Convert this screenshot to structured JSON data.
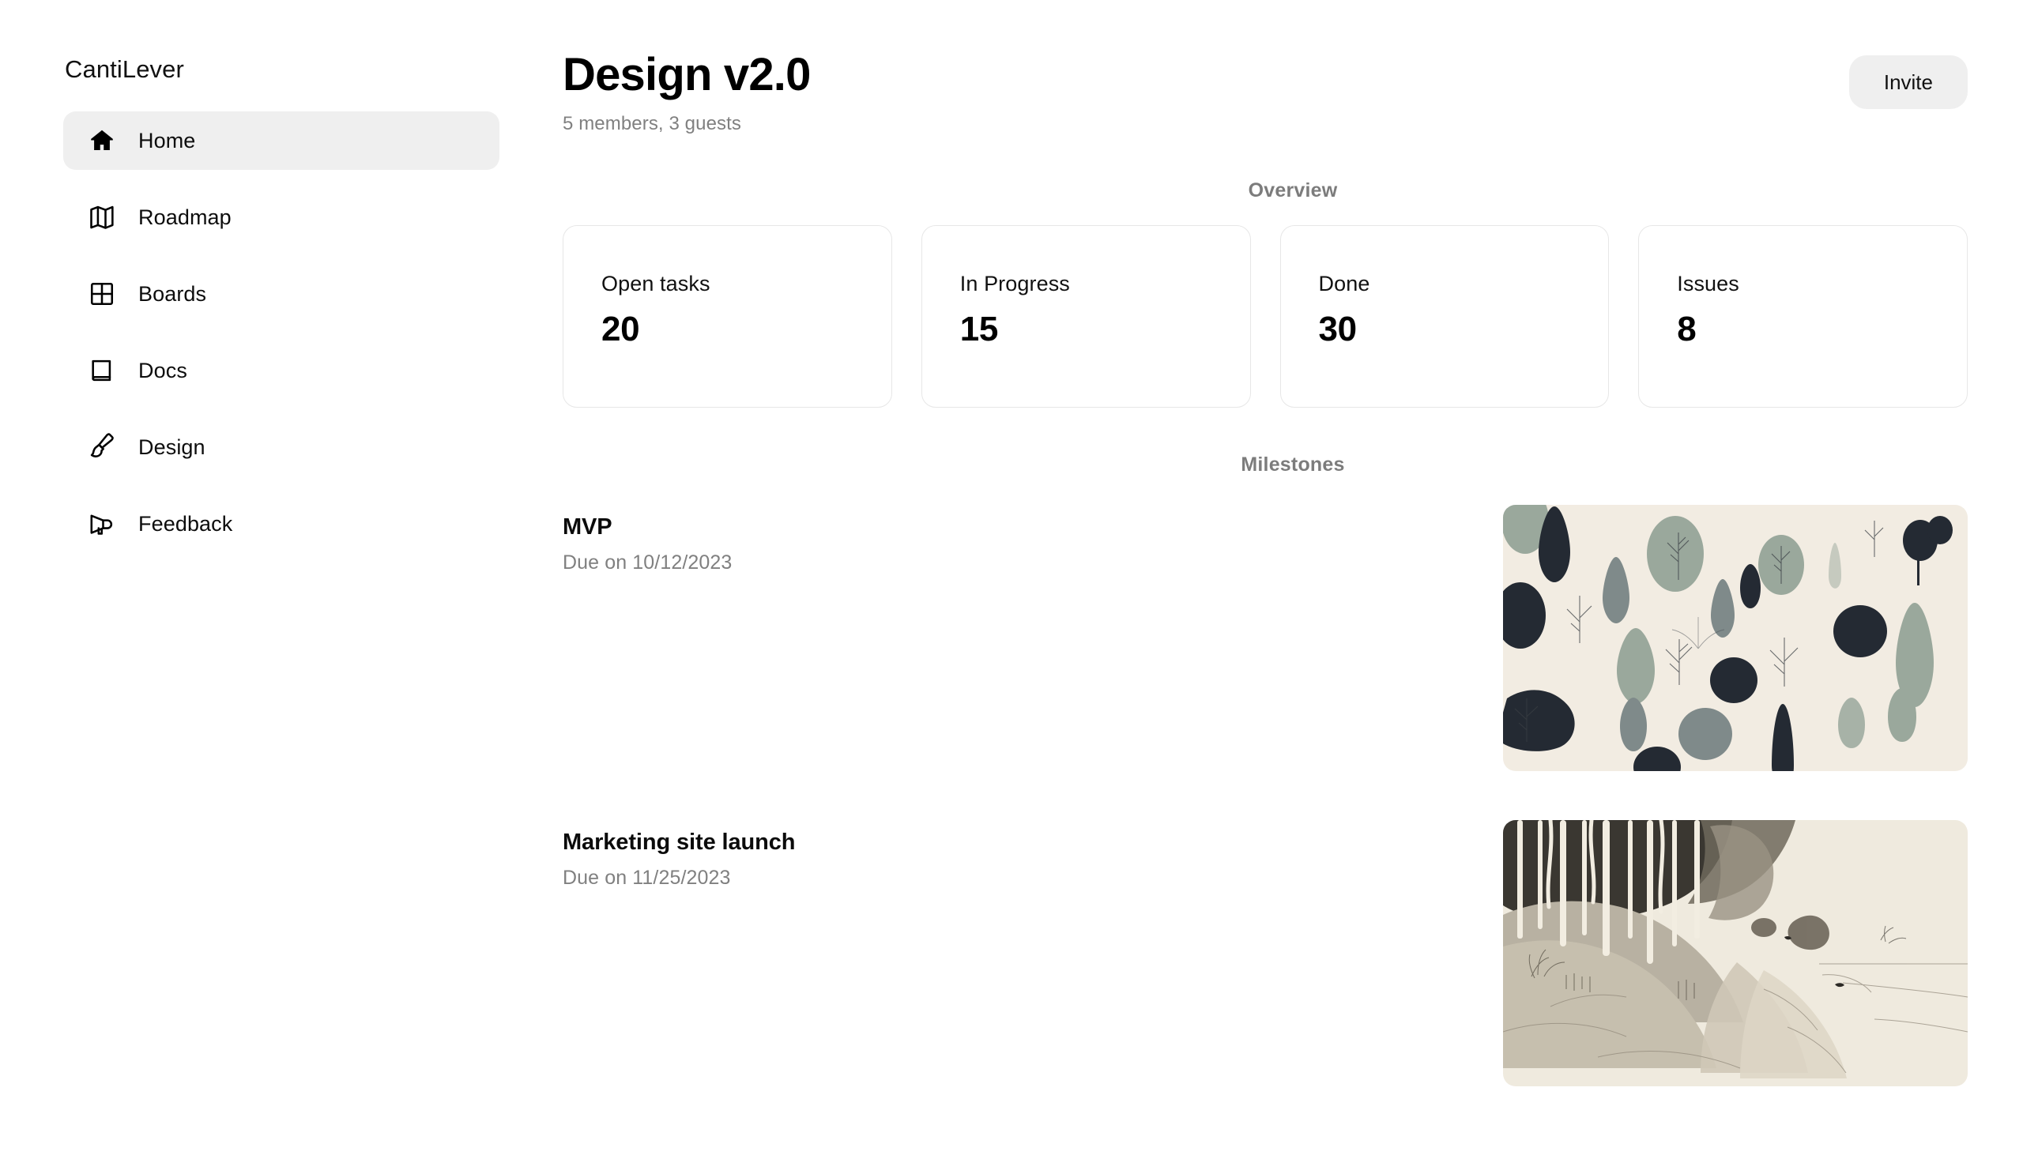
{
  "sidebar": {
    "brand": "CantiLever",
    "items": [
      {
        "label": "Home",
        "icon": "home-icon",
        "active": true
      },
      {
        "label": "Roadmap",
        "icon": "map-icon",
        "active": false
      },
      {
        "label": "Boards",
        "icon": "grid-icon",
        "active": false
      },
      {
        "label": "Docs",
        "icon": "book-icon",
        "active": false
      },
      {
        "label": "Design",
        "icon": "paintbrush-icon",
        "active": false
      },
      {
        "label": "Feedback",
        "icon": "megaphone-icon",
        "active": false
      }
    ]
  },
  "header": {
    "title": "Design v2.0",
    "subtitle": "5 members, 3 guests",
    "invite_label": "Invite"
  },
  "overview": {
    "section_label": "Overview",
    "cards": [
      {
        "label": "Open tasks",
        "value": "20"
      },
      {
        "label": "In Progress",
        "value": "15"
      },
      {
        "label": "Done",
        "value": "30"
      },
      {
        "label": "Issues",
        "value": "8"
      }
    ]
  },
  "milestones": {
    "section_label": "Milestones",
    "items": [
      {
        "title": "MVP",
        "due": "Due on 10/12/2023",
        "thumbnail": "abstract-forest-shapes-illustration"
      },
      {
        "title": "Marketing site launch",
        "due": "Due on 11/25/2023",
        "thumbnail": "sepia-birch-hillside-landscape-illustration"
      }
    ]
  },
  "colors": {
    "accent_surface": "#efefef",
    "card_border": "#e7e7e7",
    "muted_text": "#808080",
    "text": "#111111",
    "thumb1_bg": "#f2ece2",
    "thumb1_dark": "#242a33",
    "thumb1_sage": "#9aa89c",
    "thumb1_gray": "#7f8a8a",
    "thumb2_bg": "#efeade",
    "thumb2_mid": "#b8b1a2",
    "thumb2_dark": "#3a3731"
  }
}
